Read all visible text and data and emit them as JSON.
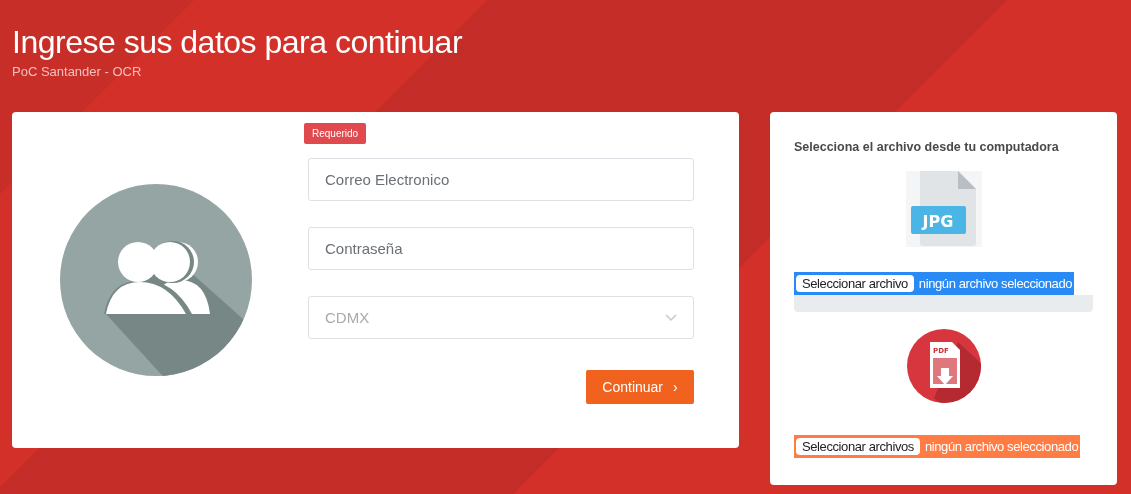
{
  "header": {
    "title": "Ingrese sus datos para continuar",
    "subtitle": "PoC Santander - OCR"
  },
  "login_form": {
    "tooltip": "Requerido",
    "fields": [
      {
        "kind": "text",
        "placeholder": "Correo Electronico"
      },
      {
        "kind": "password",
        "placeholder": "Contraseña"
      },
      {
        "kind": "select",
        "value": "CDMX"
      }
    ],
    "submit": {
      "label": "Continuar",
      "icon": "›"
    }
  },
  "upload_panel": {
    "heading": "Selecciona el archivo desde tu computadora",
    "uploads": [
      {
        "kind": "jpg",
        "label": "JPG",
        "button": "Seleccionar archivo",
        "status": "ningún archivo seleccionado"
      },
      {
        "kind": "pdf",
        "label": "PDF",
        "button": "Seleccionar archivos",
        "status": "ningún archivo seleccionado"
      }
    ]
  }
}
